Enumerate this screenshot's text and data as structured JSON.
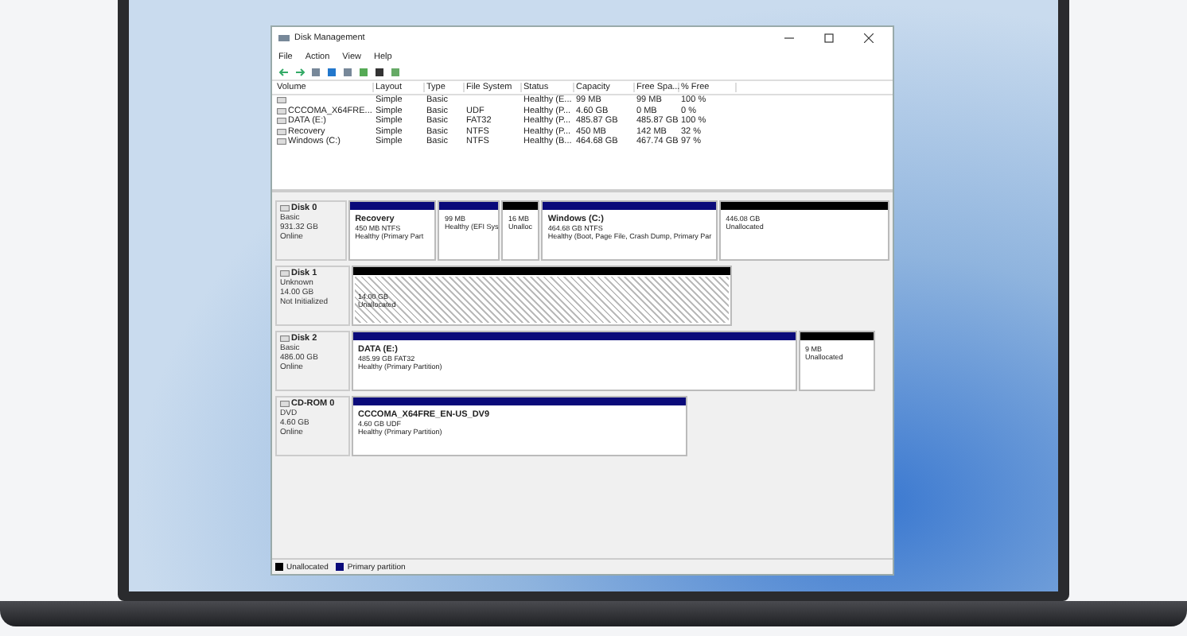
{
  "window": {
    "title": "Disk Management"
  },
  "menu": [
    "File",
    "Action",
    "View",
    "Help"
  ],
  "volume_table": {
    "columns": [
      "Volume",
      "Layout",
      "Type",
      "File System",
      "Status",
      "Capacity",
      "Free Spa...",
      "% Free"
    ],
    "rows": [
      {
        "cells": [
          "",
          "Simple",
          "Basic",
          "",
          "Healthy (E...",
          "99 MB",
          "99 MB",
          "100 %"
        ]
      },
      {
        "cells": [
          "CCCOMA_X64FRE...",
          "Simple",
          "Basic",
          "UDF",
          "Healthy (P...",
          "4.60 GB",
          "0 MB",
          "0 %"
        ]
      },
      {
        "cells": [
          "DATA (E:)",
          "Simple",
          "Basic",
          "FAT32",
          "Healthy (P...",
          "485.87 GB",
          "485.87 GB",
          "100 %"
        ]
      },
      {
        "cells": [
          "Recovery",
          "Simple",
          "Basic",
          "NTFS",
          "Healthy (P...",
          "450 MB",
          "142 MB",
          "32 %"
        ]
      },
      {
        "cells": [
          "Windows (C:)",
          "Simple",
          "Basic",
          "NTFS",
          "Healthy (B...",
          "464.68 GB",
          "467.74 GB",
          "97 %"
        ]
      }
    ]
  },
  "disks": [
    {
      "name": "Disk 0",
      "details": [
        "Basic",
        "931.32 GB",
        "Online"
      ],
      "partitions": [
        {
          "kind": "primary",
          "title": "Recovery",
          "lines": [
            "450 MB NTFS",
            "Healthy (Primary Part"
          ]
        },
        {
          "kind": "primary",
          "lines": [
            "99 MB",
            "Healthy (EFI Sys"
          ]
        },
        {
          "kind": "unallocated",
          "lines": [
            "16 MB",
            "Unalloc"
          ]
        },
        {
          "kind": "primary",
          "title": "Windows  (C:)",
          "lines": [
            "464.68 GB NTFS",
            "Healthy (Boot, Page File, Crash Dump, Primary Par"
          ]
        },
        {
          "kind": "unallocated",
          "lines": [
            "446.08 GB",
            "Unallocated"
          ]
        }
      ]
    },
    {
      "name": "Disk 1",
      "details": [
        "Unknown",
        "14.00 GB",
        "Not Initialized"
      ],
      "partitions": [
        {
          "kind": "uninitialized",
          "lines": [
            "14.00 GB",
            "Unallocated"
          ]
        }
      ]
    },
    {
      "name": "Disk 2",
      "details": [
        "Basic",
        "486.00 GB",
        "Online"
      ],
      "partitions": [
        {
          "kind": "primary",
          "title": "DATA  (E:)",
          "lines": [
            "485.99 GB FAT32",
            "Healthy (Primary Partition)"
          ]
        },
        {
          "kind": "unallocated",
          "lines": [
            "9 MB",
            "Unallocated"
          ]
        }
      ]
    },
    {
      "name": "CD-ROM 0",
      "details": [
        "DVD",
        "4.60 GB",
        "Online"
      ],
      "partitions": [
        {
          "kind": "primary",
          "title": "CCCOMA_X64FRE_EN-US_DV9",
          "lines": [
            "4.60 GB UDF",
            "Healthy (Primary Partition)"
          ]
        }
      ]
    }
  ],
  "legend": [
    {
      "label": "Unallocated",
      "color": "#000000"
    },
    {
      "label": "Primary partition",
      "color": "#0a0a7a"
    }
  ]
}
